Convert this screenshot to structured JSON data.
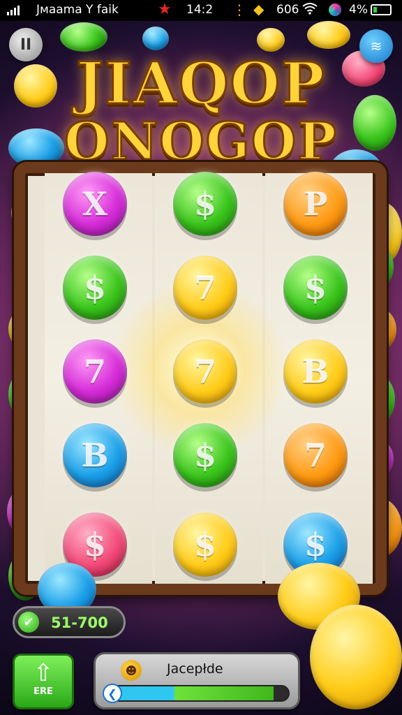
{
  "status_bar": {
    "carrier": "Jмааmа Y faik",
    "time": "14:2",
    "number": "606",
    "battery_percent": "4%",
    "wifi_icon": "wifi-icon",
    "battery_level": 0.04
  },
  "header": {
    "pause_label": "II",
    "menu_icon": "layers-icon",
    "title_line1": "JIAQOP",
    "title_line2": "ONOGOP"
  },
  "reels": [
    [
      {
        "symbol": "X",
        "color": "#d52bd8"
      },
      {
        "symbol": "$",
        "color": "#39c41b"
      },
      {
        "symbol": "7",
        "color": "#d52bd8"
      },
      {
        "symbol": "B",
        "color": "#1a9fe8"
      },
      {
        "symbol": "$",
        "color": "#f24a78"
      }
    ],
    [
      {
        "symbol": "$",
        "color": "#39c41b"
      },
      {
        "symbol": "7",
        "color": "#ffcc18"
      },
      {
        "symbol": "7",
        "color": "#ffcc18"
      },
      {
        "symbol": "$",
        "color": "#39c41b"
      },
      {
        "symbol": "$",
        "color": "#ffcc18"
      }
    ],
    [
      {
        "symbol": "P",
        "color": "#ff9a12"
      },
      {
        "symbol": "$",
        "color": "#39c41b"
      },
      {
        "symbol": "B",
        "color": "#ffcc18"
      },
      {
        "symbol": "7",
        "color": "#ff9a12"
      },
      {
        "symbol": "$",
        "color": "#1a9fe8"
      }
    ]
  ],
  "balance": {
    "value": "51-700",
    "icon": "check-icon"
  },
  "ere_button": {
    "label": "ERE",
    "icon": "up-arrow-icon"
  },
  "progress": {
    "label": "Jacepłde",
    "face_icon": "face-icon",
    "back_icon": "back-arrow-icon",
    "value": 0.92
  }
}
